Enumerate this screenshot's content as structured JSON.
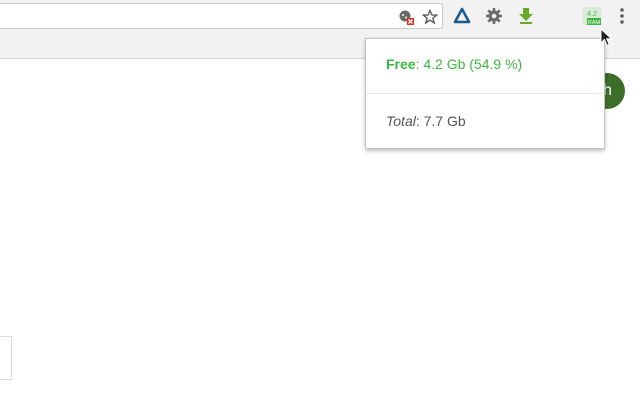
{
  "toolbar": {
    "extensions": [
      {
        "icon": "triangle-app-icon",
        "color": "#1c5a8c"
      },
      {
        "icon": "gear-extension-icon",
        "color": "#6b6b6b"
      },
      {
        "icon": "download-arrow-icon",
        "color": "#6aa829"
      },
      {
        "icon": "ram-monitor-icon",
        "color": "#3fb542",
        "badge": "RAM"
      }
    ]
  },
  "avatar": {
    "letter": "h",
    "color": "#3c6e2a"
  },
  "popup": {
    "free_label": "Free",
    "free_value": ": 4.2 Gb (54.9 %)",
    "total_label": "Total",
    "total_value": ": 7.7 Gb"
  },
  "colors": {
    "free_green": "#3fb542",
    "toolbar_bg": "#f2f2f2"
  }
}
